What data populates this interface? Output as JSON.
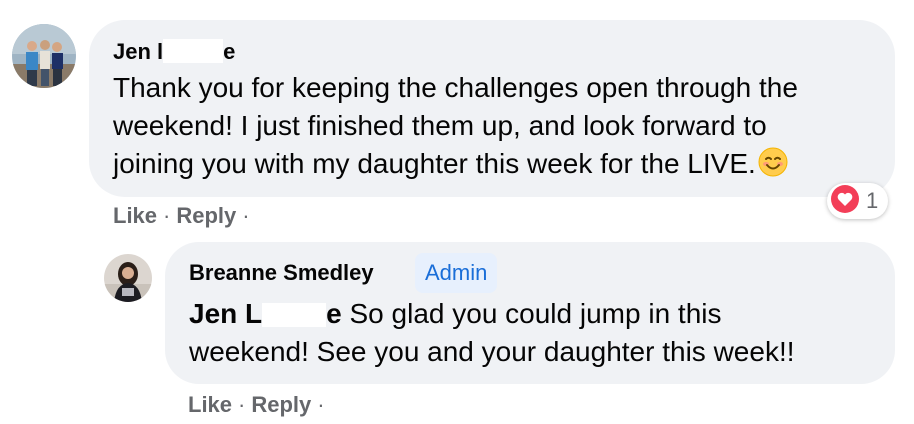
{
  "comment": {
    "author_visible_start": "Jen l",
    "author_visible_end": "e",
    "lines": [
      "Thank you for keeping the challenges open through the",
      "weekend! I just finished them up, and look forward to",
      "joining you with my daughter this week for the LIVE."
    ],
    "reaction_count": "1",
    "like_label": "Like",
    "reply_label": "Reply",
    "separator": "·"
  },
  "reply": {
    "author": "Breanne Smedley",
    "badge": "Admin",
    "mention_start": "Jen L",
    "mention_end": "e",
    "line1_rest": " So glad you could jump in this",
    "line2": "weekend! See you and your daughter this week!!",
    "like_label": "Like",
    "reply_label": "Reply",
    "separator": "·"
  },
  "colors": {
    "bubble_bg": "#f0f2f5",
    "text": "#050505",
    "secondary_text": "#65676b",
    "admin_badge_bg": "#e7f0fd",
    "admin_badge_text": "#1a6ed8",
    "love_reaction": "#f33e58"
  },
  "icons": {
    "reaction": "love-reaction-icon",
    "emoji": "smiling-face-emoji-icon"
  }
}
